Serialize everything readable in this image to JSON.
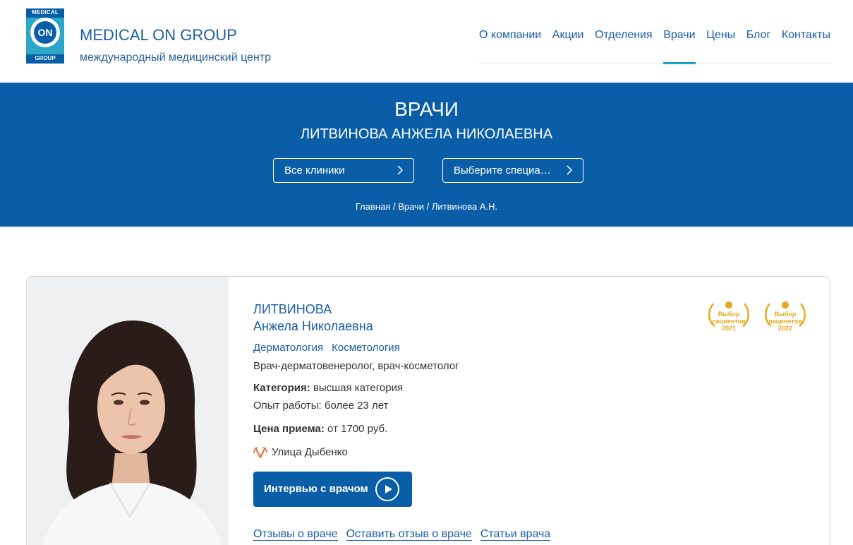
{
  "header": {
    "logo": {
      "top": "MEDICAL",
      "center": "ON",
      "bottom": "GROUP"
    },
    "brand_title": "MEDICAL ON GROUP",
    "brand_subtitle": "международный медицинский центр",
    "nav": [
      {
        "label": "О компании"
      },
      {
        "label": "Акции"
      },
      {
        "label": "Отделения"
      },
      {
        "label": "Врачи",
        "active": true
      },
      {
        "label": "Цены"
      },
      {
        "label": "Блог"
      },
      {
        "label": "Контакты"
      }
    ]
  },
  "hero": {
    "title": "ВРАЧИ",
    "doctor_name": "ЛИТВИНОВА АНЖЕЛА НИКОЛАЕВНА",
    "clinic_select": "Все клиники",
    "specialty_select": "Выберите специа…",
    "breadcrumb": "Главная / Врачи / Литвинова А.Н."
  },
  "doctor": {
    "surname": "ЛИТВИНОВА",
    "first_name": "Анжела Николаевна",
    "specialties": [
      "Дерматология",
      "Косметология"
    ],
    "role": "Врач-дерматовенеролог, врач-косметолог",
    "category_label": "Категория:",
    "category_value": " высшая категория",
    "experience": "Опыт работы: более 23 лет",
    "price_label": "Цена приема:",
    "price_value": " от 1700 руб.",
    "metro": "Улица Дыбенко",
    "interview_button": "Интервью с врачом",
    "links": [
      "Отзывы о враче",
      "Оставить отзыв о враче",
      "Статьи врача"
    ],
    "awards": [
      {
        "line1": "Выбор",
        "line2": "пациентов",
        "year": "2021"
      },
      {
        "line1": "Выбор",
        "line2": "пациентов",
        "year": "2022"
      }
    ]
  },
  "colors": {
    "brand_blue": "#0a5ea8",
    "accent_cyan": "#1aa3c8",
    "award_gold": "#e5a91a",
    "metro_orange": "#e8703a"
  }
}
